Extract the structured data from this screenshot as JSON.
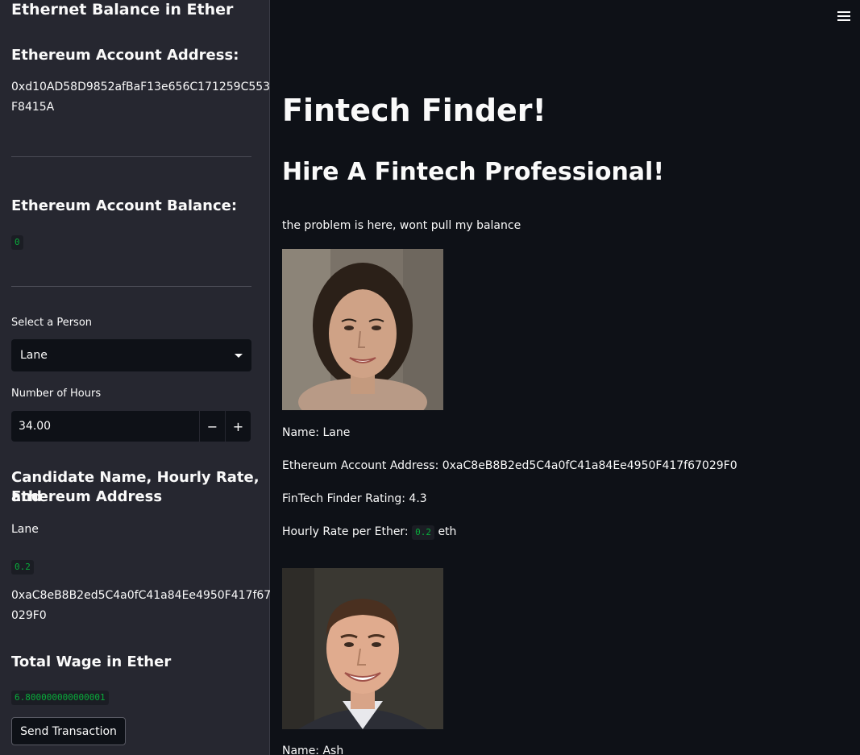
{
  "sidebar": {
    "title": "Ethernet Balance in Ether",
    "account_address_heading": "Ethereum Account Address:",
    "account_address_line1": "0xd10AD58D9852afBaF13e656C171259C553",
    "account_address_line2": "F8415A",
    "account_balance_heading": "Ethereum Account Balance:",
    "account_balance": "0",
    "select_label": "Select a Person",
    "select_value": "Lane",
    "hours_label": "Number of Hours",
    "hours_value": "34.00",
    "minus_label": "−",
    "plus_label": "+",
    "candidate_heading_line1": "Candidate Name, Hourly Rate, and",
    "candidate_heading_line2": "Ethereum Address",
    "candidate_name": "Lane",
    "candidate_rate": "0.2",
    "candidate_address_line1": "0xaC8eB8B2ed5C4a0fC41a84Ee4950F417f67",
    "candidate_address_line2": "029F0",
    "total_wage_heading": "Total Wage in Ether",
    "total_wage": "6.800000000000001",
    "send_button": "Send Transaction"
  },
  "main": {
    "title": "Fintech Finder!",
    "subtitle": "Hire A Fintech Professional!",
    "note": "the problem is here, wont pull my balance",
    "candidates": [
      {
        "name_line": "Name: Lane",
        "address_line": "Ethereum Account Address: 0xaC8eB8B2ed5C4a0fC41a84Ee4950F417f67029F0",
        "rating_line": "FinTech Finder Rating: 4.3",
        "rate_prefix": "Hourly Rate per Ether:",
        "rate_value": "0.2",
        "rate_suffix": "eth"
      },
      {
        "name_line": "Name: Ash"
      }
    ]
  },
  "icons": {
    "menu": "hamburger-menu-icon",
    "dropdown": "chevron-down-icon"
  },
  "colors": {
    "background": "#0e1117",
    "sidebar": "#262730",
    "code": "#09ab3b"
  }
}
